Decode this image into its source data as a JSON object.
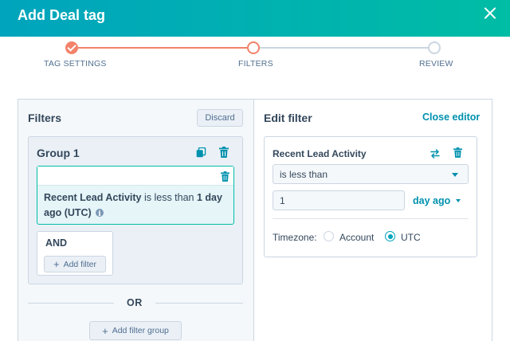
{
  "modal": {
    "title": "Add Deal tag"
  },
  "stepper": {
    "steps": [
      {
        "label": "TAG SETTINGS",
        "state": "done"
      },
      {
        "label": "FILTERS",
        "state": "current"
      },
      {
        "label": "REVIEW",
        "state": "pending"
      }
    ]
  },
  "filters_panel": {
    "title": "Filters",
    "discard_label": "Discard",
    "group": {
      "title": "Group 1",
      "filter": {
        "property": "Recent Lead Activity",
        "operator_text": " is less than ",
        "value_text": "1 day ago",
        "tz_text": " (UTC)"
      },
      "and_label": "AND",
      "add_filter_label": "Add filter"
    },
    "or_label": "OR",
    "add_group_label": "Add filter group"
  },
  "edit_panel": {
    "title": "Edit filter",
    "close_label": "Close editor",
    "property": "Recent Lead Activity",
    "operator": "is less than",
    "value": "1",
    "unit": "day ago",
    "timezone_label": "Timezone:",
    "timezone_options": [
      "Account",
      "UTC"
    ],
    "timezone_selected": "UTC"
  },
  "colors": {
    "header_start": "#00a4bd",
    "header_end": "#00bda5",
    "step_done": "#f2826a",
    "link": "#0091ae",
    "accent_border": "#00bda5"
  }
}
